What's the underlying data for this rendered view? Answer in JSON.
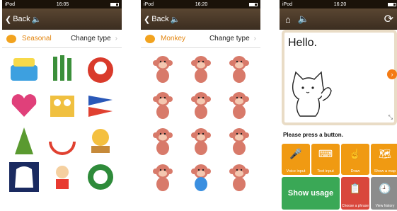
{
  "panels": [
    {
      "status": {
        "carrier": "iPod",
        "time": "16:05"
      },
      "nav": {
        "back_label": "Back"
      },
      "typebar": {
        "category": "Seasonal",
        "change_label": "Change type"
      },
      "stickers": [
        "birthday-cake",
        "kadomatsu",
        "daruma",
        "love-heart",
        "hina-dolls",
        "koinobori",
        "tanabata",
        "watermelon",
        "tsukimi",
        "ghost",
        "sports-day",
        "christmas-wreath"
      ]
    },
    {
      "status": {
        "carrier": "iPod",
        "time": "16:20"
      },
      "nav": {
        "back_label": "Back"
      },
      "typebar": {
        "category": "Monkey",
        "change_label": "Change type"
      },
      "stickers": [
        "monkey-01",
        "monkey-02",
        "monkey-03",
        "monkey-04",
        "monkey-05",
        "monkey-06",
        "monkey-07",
        "monkey-08",
        "monkey-09",
        "monkey-10",
        "monkey-11",
        "monkey-12"
      ]
    }
  ],
  "panel3": {
    "status": {
      "carrier": "iPod",
      "time": "16:20"
    },
    "board_text": "Hello.",
    "prompt": "Please press a button.",
    "buttons_row1": [
      {
        "label": "Voice input",
        "icon": "microphone-icon",
        "glyph": "🎤"
      },
      {
        "label": "Text input",
        "icon": "keyboard-icon",
        "glyph": "⌨"
      },
      {
        "label": "Draw",
        "icon": "draw-hand-icon",
        "glyph": "☝"
      },
      {
        "label": "Show a map",
        "icon": "map-icon",
        "glyph": "🗺"
      }
    ],
    "usage_label": "Show usage",
    "choose_phrase_label": "Choose a phrase",
    "view_history_label": "View history"
  },
  "colors": {
    "accent": "#e2840e",
    "orange_btn": "#f09a12",
    "green_btn": "#3aa856",
    "red_btn": "#d9473c",
    "grey_btn": "#8c8c8c",
    "navbar": "#4a3a2a"
  }
}
